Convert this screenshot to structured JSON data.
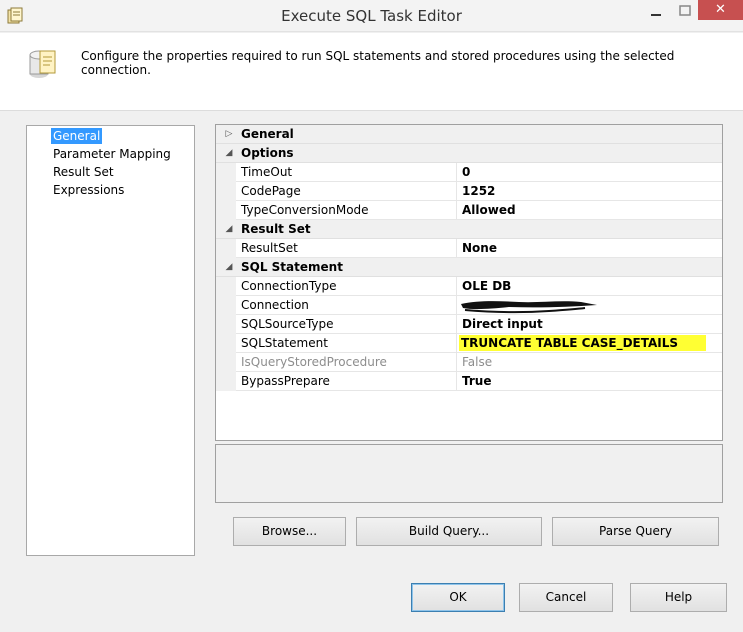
{
  "window": {
    "title": "Execute SQL Task Editor",
    "close_glyph": "✕"
  },
  "banner": {
    "description": "Configure the properties required to run SQL statements and stored procedures using the selected connection."
  },
  "nav": {
    "items": [
      {
        "label": "General",
        "selected": true
      },
      {
        "label": "Parameter Mapping"
      },
      {
        "label": "Result Set"
      },
      {
        "label": "Expressions"
      }
    ]
  },
  "grid": {
    "general": {
      "category": "General"
    },
    "options": {
      "category": "Options",
      "timeout": {
        "name": "TimeOut",
        "value": "0"
      },
      "codepage": {
        "name": "CodePage",
        "value": "1252"
      },
      "typeconversion": {
        "name": "TypeConversionMode",
        "value": "Allowed"
      }
    },
    "resultset": {
      "category": "Result Set",
      "resultset": {
        "name": "ResultSet",
        "value": "None"
      }
    },
    "sqlstatement": {
      "category": "SQL Statement",
      "connectiontype": {
        "name": "ConnectionType",
        "value": "OLE DB"
      },
      "connection": {
        "name": "Connection"
      },
      "sqlsourcetype": {
        "name": "SQLSourceType",
        "value": "Direct input"
      },
      "sqlstatement": {
        "name": "SQLStatement",
        "value": "TRUNCATE TABLE CASE_DETAILS"
      },
      "isquerystored": {
        "name": "IsQueryStoredProcedure",
        "value": "False"
      },
      "bypassprepare": {
        "name": "BypassPrepare",
        "value": "True"
      }
    }
  },
  "buttons": {
    "browse": "Browse...",
    "build_query": "Build Query...",
    "parse_query": "Parse Query",
    "ok": "OK",
    "cancel": "Cancel",
    "help": "Help"
  },
  "colors": {
    "selection": "#3399ff",
    "highlight": "#ffff33",
    "close": "#c75050"
  }
}
